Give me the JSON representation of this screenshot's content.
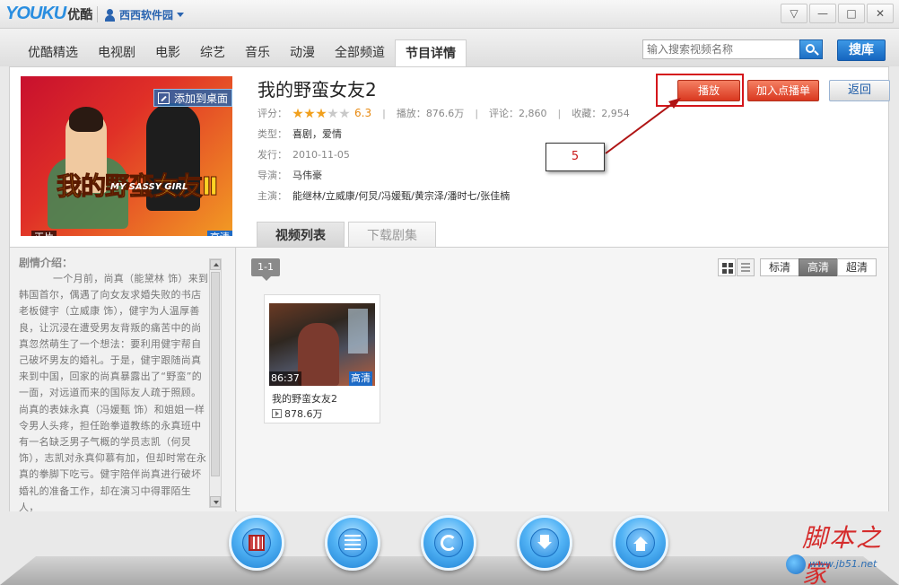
{
  "app": {
    "logo_brand": "YOUKU",
    "logo_cn": "优酷",
    "user_name": "西西软件园"
  },
  "window_buttons": [
    "▽",
    "—",
    "□",
    "✕"
  ],
  "nav": {
    "tabs": [
      {
        "label": "优酷精选"
      },
      {
        "label": "电视剧"
      },
      {
        "label": "电影"
      },
      {
        "label": "综艺"
      },
      {
        "label": "音乐"
      },
      {
        "label": "动漫"
      },
      {
        "label": "全部频道"
      },
      {
        "label": "节目详情",
        "active": true
      }
    ],
    "search_placeholder": "输入搜索视频名称",
    "soku_label": "搜库"
  },
  "poster": {
    "add_desktop": "添加到桌面",
    "title_art": "我的野蛮女友Ⅱ",
    "eng_art": "MY SASSY GIRL",
    "badge_type": "正片",
    "badge_quality": "高清"
  },
  "movie": {
    "title": "我的野蛮女友2",
    "rating_label": "评分：",
    "rating_stars": 3,
    "rating_max": 5,
    "rating_value": "6.3",
    "plays_label": "播放：",
    "plays_value": "876.6万",
    "comments_label": "评论：",
    "comments_value": "2,860",
    "favs_label": "收藏：",
    "favs_value": "2,954",
    "genre_label": "类型：",
    "genre_value": "喜剧，爱情",
    "release_label": "发行：",
    "release_value": "2010-11-05",
    "director_label": "导演：",
    "director_value": "马伟豪",
    "cast_label": "主演：",
    "cast_value": "能继林/立威康/何炅/冯媛甄/黄宗泽/潘时七/张佳楠"
  },
  "actions": {
    "play": "播放",
    "add_playlist": "加入点播单",
    "back": "返回"
  },
  "callout": {
    "label": "5",
    "highlight_color": "#d4161b"
  },
  "subtabs": [
    {
      "label": "视频列表",
      "active": true
    },
    {
      "label": "下载剧集",
      "active": false
    }
  ],
  "synopsis": {
    "title": "剧情介绍：",
    "text": "一个月前，尚真（能黛林 饰）来到韩国首尔，偶遇了向女友求婚失败的书店老板健宇（立威康 饰），健宇为人温厚善良，让沉浸在遭受男友背叛的痛苦中的尚真忽然萌生了一个想法：要利用健宇帮自己破坏男友的婚礼。于是，健宇跟随尚真来到中国，回家的尚真暴露出了“野蛮”的一面，对远道而来的国际友人疏于照顾。尚真的表妹永真（冯媛甄 饰）和姐姐一样令男人头疼，担任跆拳道教练的永真班中有一名缺乏男子气概的学员志凯（何炅 饰），志凯对永真仰慕有加，但却时常在永真的拳脚下吃亏。健宇陪伴尚真进行破坏婚礼的准备工作，却在演习中得罪陌生人，"
  },
  "episodes": {
    "range": "1-1",
    "quality_options": [
      {
        "label": "标清",
        "active": false
      },
      {
        "label": "高清",
        "active": true
      },
      {
        "label": "超清",
        "active": false
      }
    ],
    "items": [
      {
        "title": "我的野蛮女友2",
        "duration": "86:37",
        "quality": "高清",
        "plays": "878.6万"
      }
    ]
  },
  "dock": [
    "film-icon",
    "playlist-icon",
    "refresh-icon",
    "download-icon",
    "upload-icon"
  ],
  "watermark": {
    "cn": "脚本之家",
    "url": "www.jb51.net"
  }
}
